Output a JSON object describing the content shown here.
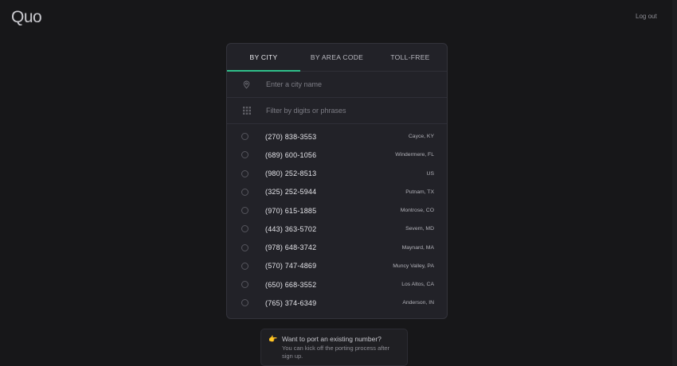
{
  "header": {
    "logo": "Quo",
    "logout_label": "Log out"
  },
  "tabs": [
    {
      "label": "BY CITY",
      "active": true
    },
    {
      "label": "BY AREA CODE",
      "active": false
    },
    {
      "label": "TOLL-FREE",
      "active": false
    }
  ],
  "city_input": {
    "placeholder": "Enter a city name",
    "icon": "location-pin-icon"
  },
  "filter_input": {
    "placeholder": "Filter by digits or phrases",
    "icon": "keypad-icon"
  },
  "numbers": [
    {
      "number": "(270) 838-3553",
      "location": "Cayce, KY"
    },
    {
      "number": "(689) 600-1056",
      "location": "Windermere, FL"
    },
    {
      "number": "(980) 252-8513",
      "location": "US"
    },
    {
      "number": "(325) 252-5944",
      "location": "Putnam, TX"
    },
    {
      "number": "(970) 615-1885",
      "location": "Montrose, CO"
    },
    {
      "number": "(443) 363-5702",
      "location": "Severn, MD"
    },
    {
      "number": "(978) 648-3742",
      "location": "Maynard, MA"
    },
    {
      "number": "(570) 747-4869",
      "location": "Muncy Valley, PA"
    },
    {
      "number": "(650) 668-3552",
      "location": "Los Altos, CA"
    },
    {
      "number": "(765) 374-6349",
      "location": "Anderson, IN"
    }
  ],
  "port_hint": {
    "title": "Want to port an existing number?",
    "body": "You can kick off the porting process after sign up.",
    "icon": "pointing-hand-icon"
  },
  "colors": {
    "accent": "#2fbf8a",
    "background": "#171719",
    "panel": "#222228"
  }
}
